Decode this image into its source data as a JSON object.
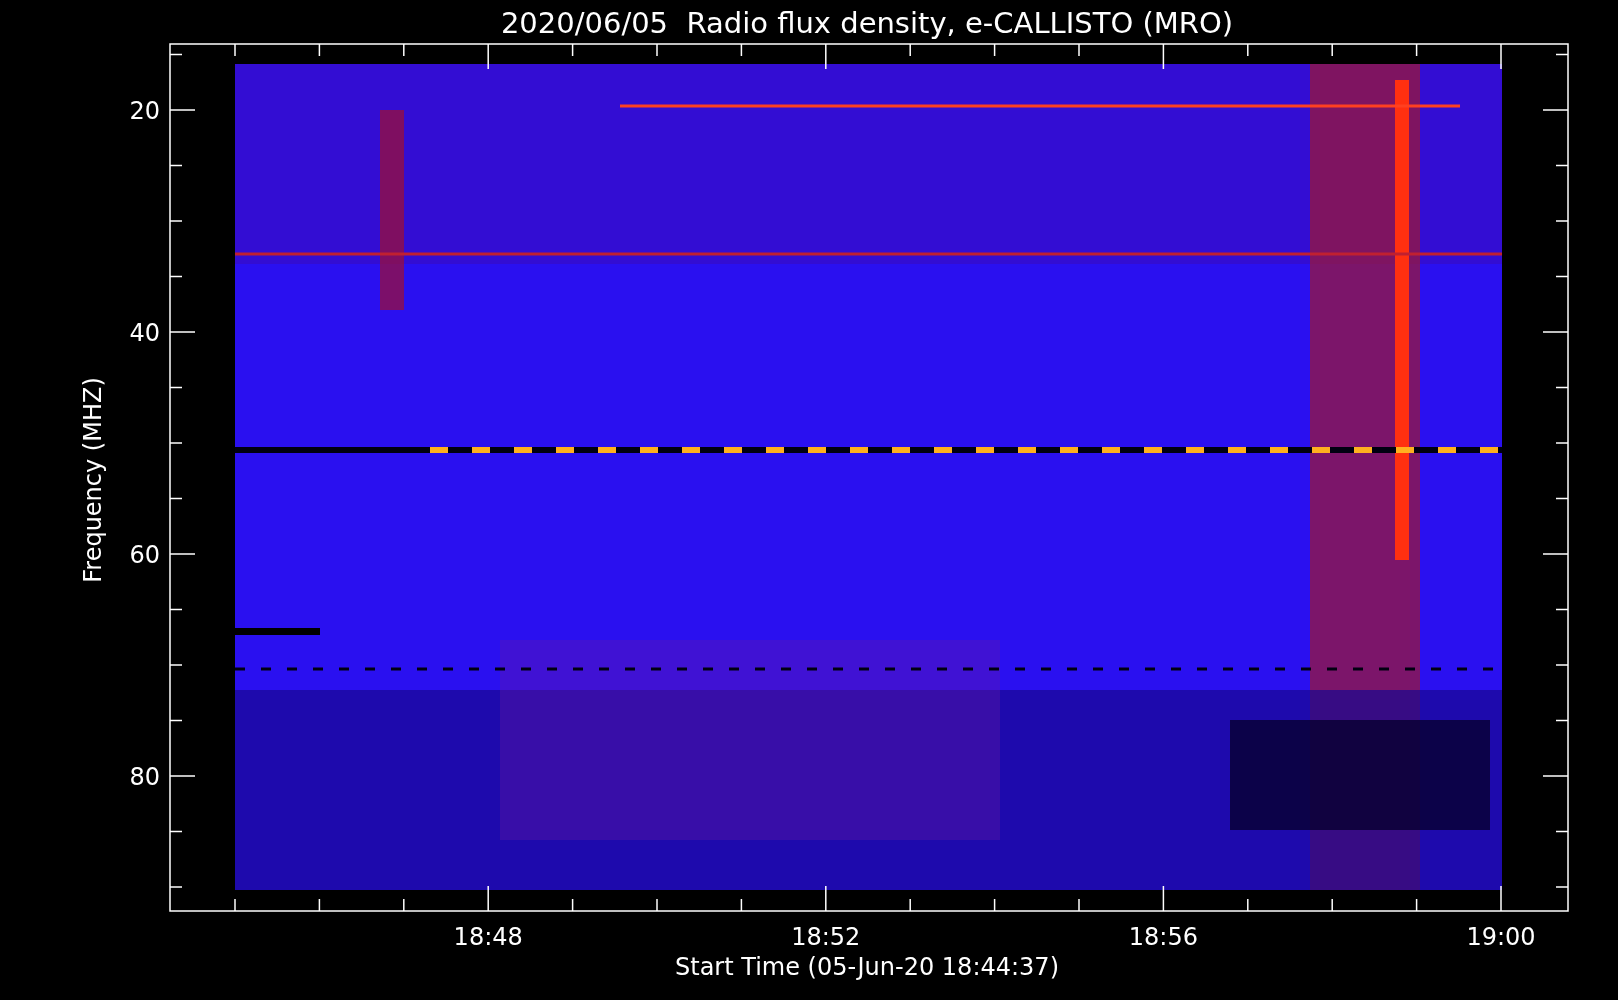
{
  "title": "2020/06/05  Radio flux density, e-CALLISTO (MRO)",
  "y_axis": {
    "label": "Frequency (MHZ)",
    "tick_labels": [
      "20",
      "40",
      "60",
      "80"
    ]
  },
  "x_axis": {
    "label": "Start Time (05-Jun-20 18:44:37)",
    "tick_labels": [
      "18:48",
      "18:52",
      "18:56",
      "19:00"
    ]
  }
}
